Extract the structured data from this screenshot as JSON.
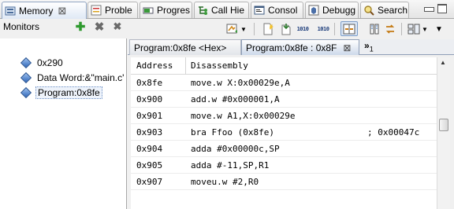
{
  "view_tabs": [
    {
      "label": "Memory",
      "icon": "memory-icon",
      "has_close": true,
      "active": true
    },
    {
      "label": "Proble",
      "icon": "problems-icon"
    },
    {
      "label": "Progres",
      "icon": "progress-icon"
    },
    {
      "label": "Call Hie",
      "icon": "call-hierarchy-icon"
    },
    {
      "label": "Consol",
      "icon": "console-icon"
    },
    {
      "label": "Debugg",
      "icon": "debugger-icon"
    },
    {
      "label": "Search",
      "icon": "search-icon"
    }
  ],
  "close_glyph": "⊠",
  "monitors": {
    "title": "Monitors",
    "add_glyph": "✚",
    "remove_glyph": "✖",
    "remove_all_glyph": "✖",
    "items": [
      {
        "label": "0x290"
      },
      {
        "label": "Data Word:&\"main.c'"
      },
      {
        "label": "Program:0x8fe",
        "selected": true
      }
    ]
  },
  "toolbar": {
    "buttons": [
      "new-rendering-icon",
      "new-monitor-icon",
      "import-icon",
      "binary-1010-icon",
      "binary-1010-alt-icon",
      "toggle-split-icon",
      "column-layout-icon",
      "link-icon",
      "view-menu-icon"
    ],
    "bin_a": "1010",
    "bin_b": "1010"
  },
  "rendering_tabs": [
    {
      "label": "Program:0x8fe <Hex>"
    },
    {
      "label": "Program:0x8fe : 0x8F",
      "active": true,
      "close": "⊠"
    }
  ],
  "overflow": {
    "chevron": "»",
    "count": "1"
  },
  "table": {
    "headers": {
      "address": "Address",
      "disassembly": "Disassembly"
    },
    "rows": [
      {
        "address": "0x8fe",
        "instr": "move.w X:0x00029e,A",
        "comment": ""
      },
      {
        "address": "0x900",
        "instr": "add.w #0x000001,A",
        "comment": ""
      },
      {
        "address": "0x901",
        "instr": "move.w A1,X:0x00029e",
        "comment": ""
      },
      {
        "address": "0x903",
        "instr": "bra Ffoo (0x8fe)",
        "comment": "; 0x00047c"
      },
      {
        "address": "0x904",
        "instr": "adda #0x00000c,SP",
        "comment": ""
      },
      {
        "address": "0x905",
        "instr": "adda #-11,SP,R1",
        "comment": ""
      },
      {
        "address": "0x907",
        "instr": "moveu.w #2,R0",
        "comment": ""
      }
    ]
  },
  "colors": {
    "selection_border": "#6b8fc4",
    "active_tab": "#dfe8f5",
    "tab_border": "#8e9eb7"
  }
}
